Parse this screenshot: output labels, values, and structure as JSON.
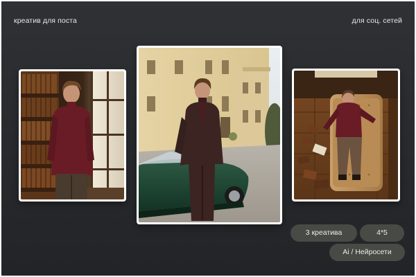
{
  "header": {
    "left_text": "креатив для поста",
    "right_text": "для соц. сетей"
  },
  "tags": {
    "count": "3 креатива",
    "ratio": "4*5",
    "ai": "Ai / Нейросети"
  }
}
